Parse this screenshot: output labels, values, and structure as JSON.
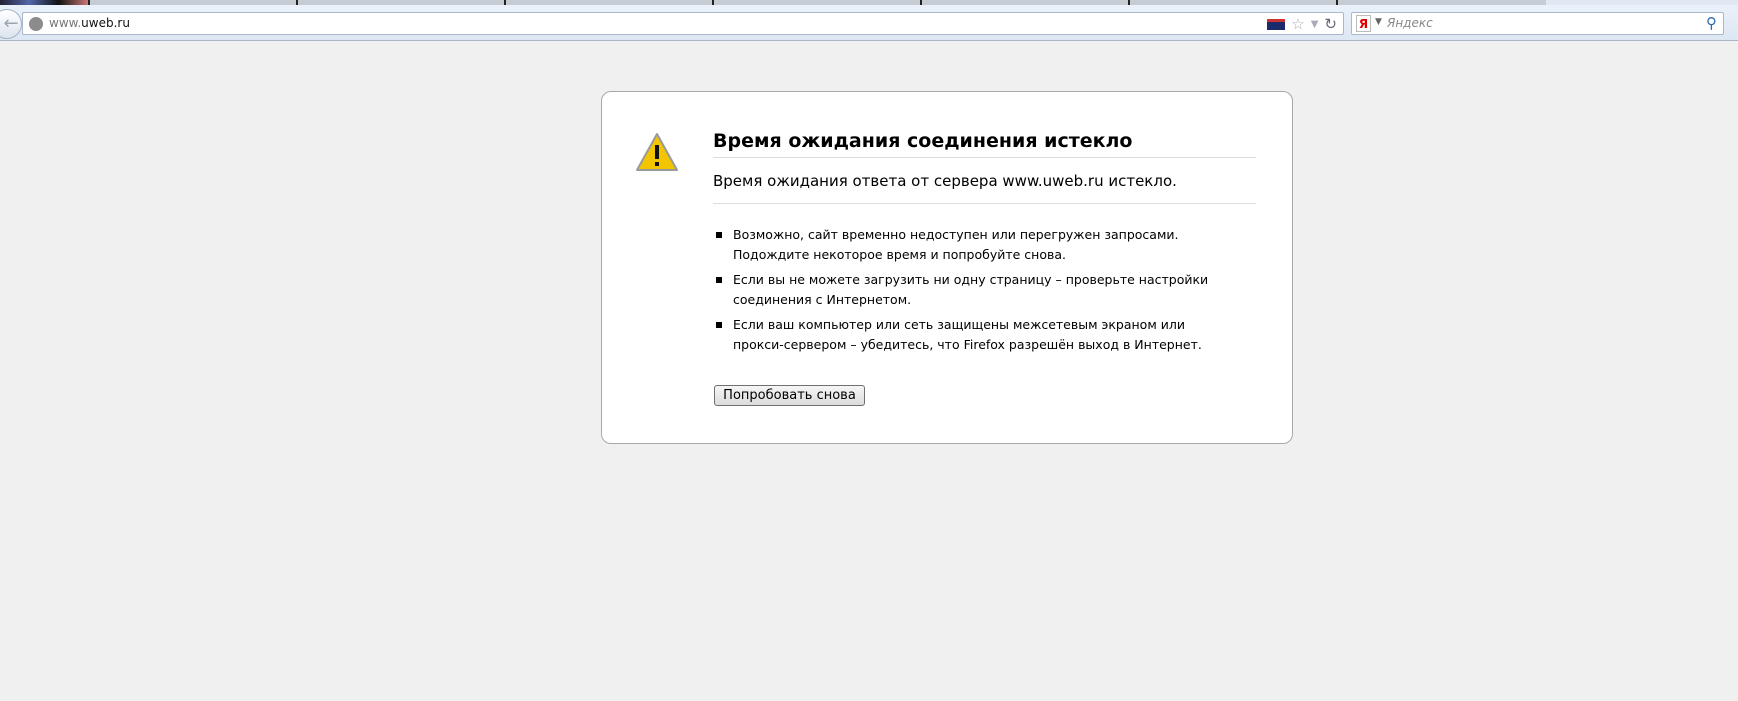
{
  "browser": {
    "url_prefix": "www.",
    "url_domain": "uweb.ru",
    "search_placeholder": "Яндекс",
    "search_engine_logo": "Я"
  },
  "error": {
    "title": "Время ожидания соединения истекло",
    "subtitle": "Время ожидания ответа от сервера www.uweb.ru истекло.",
    "items": [
      "Возможно, сайт временно недоступен или перегружен запросами. Подождите некоторое время и попробуйте снова.",
      "Если вы не можете загрузить ни одну страницу – проверьте настройки соединения с Интернетом.",
      "Если ваш компьютер или сеть защищены межсетевым экраном или прокси-сервером – убедитесь, что Firefox разрешён выход в Интернет."
    ],
    "retry_label": "Попробовать снова"
  },
  "colors": {
    "page_bg": "#f0f0f0",
    "warning": "#f2c500"
  }
}
